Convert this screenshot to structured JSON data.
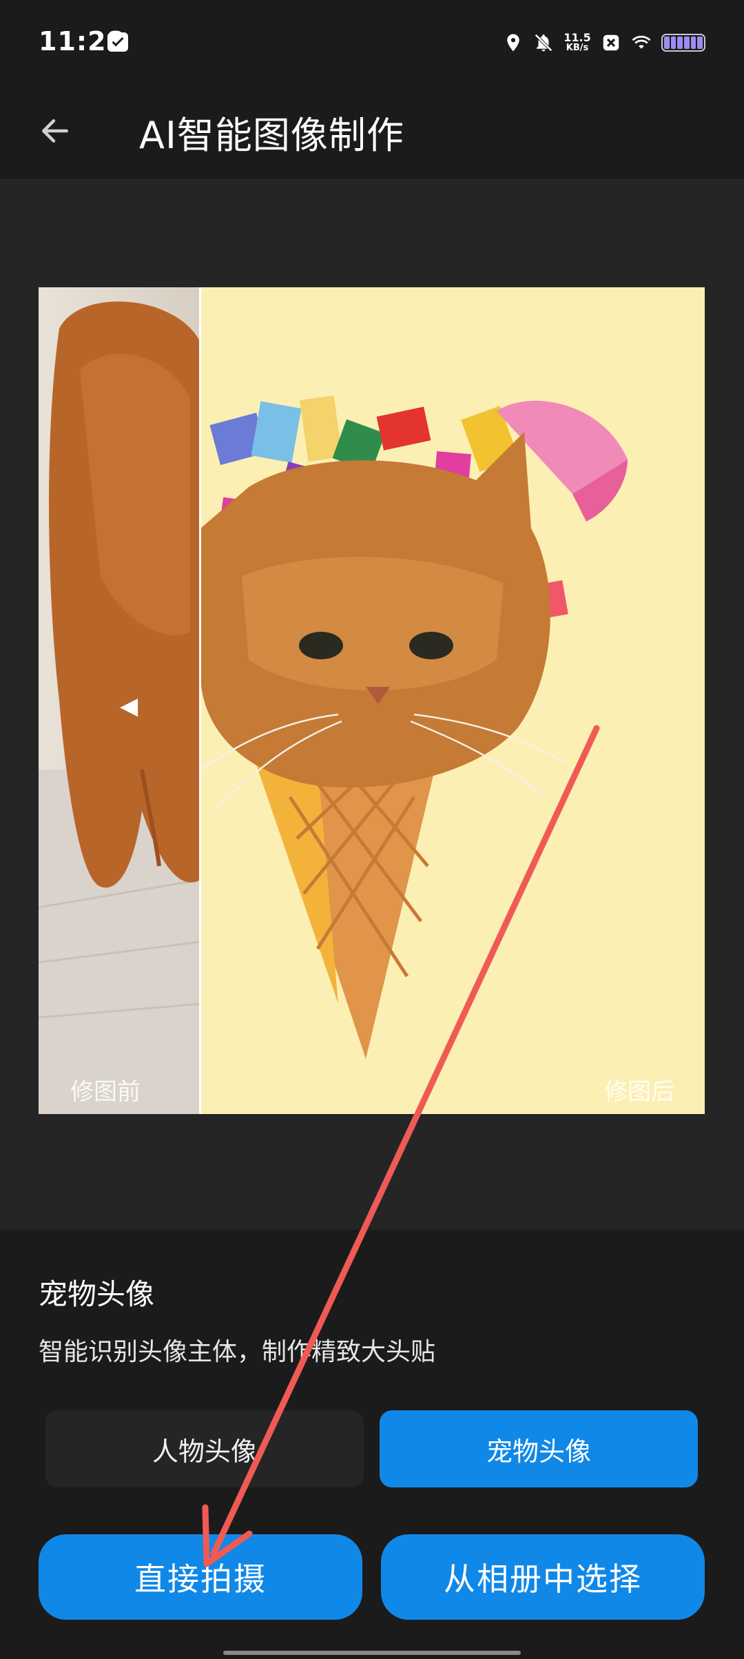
{
  "status_bar": {
    "time": "11:28",
    "net_speed": "11.5",
    "net_speed_unit": "KB/s"
  },
  "app_bar": {
    "title": "AI智能图像制作"
  },
  "preview": {
    "before_label": "修图前",
    "after_label": "修图后",
    "handle_glyph": "◀"
  },
  "info": {
    "category_title": "宠物头像",
    "category_desc": "智能识别头像主体，制作精致大头贴",
    "chips": [
      {
        "label": "人物头像",
        "selected": false
      },
      {
        "label": "宠物头像",
        "selected": true
      }
    ]
  },
  "actions": {
    "camera_label": "直接拍摄",
    "album_label": "从相册中选择"
  },
  "colors": {
    "accent": "#1088e8",
    "background": "#1b1b1c",
    "preview_bg": "#252526",
    "after_bg": "#fcefb4",
    "annotation_arrow": "#f05a55"
  }
}
